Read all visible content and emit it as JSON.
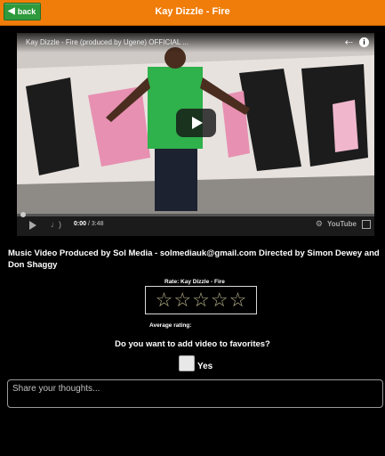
{
  "header": {
    "back_label": "back",
    "title": "Kay Dizzle - Fire",
    "bar_color": "#f07d0a",
    "back_color": "#2e9a3c"
  },
  "video": {
    "title": "Kay Dizzle - Fire (produced by Ugene) OFFICIAL ...",
    "time_current": "0:00",
    "time_total": " / 3:48",
    "brand": "YouTube"
  },
  "description": "Music Video Produced by Sol Media - solmediauk@gmail.com Directed by Simon Dewey and Don Shaggy",
  "rating": {
    "label": "Rate: Kay Dizzle - Fire",
    "stars": [
      "☆",
      "☆",
      "☆",
      "☆",
      "☆"
    ],
    "average_label": "Average rating:"
  },
  "favorites": {
    "question": "Do you want to add video to favorites?",
    "yes_label": "Yes",
    "checked": false
  },
  "comment": {
    "placeholder": "Share your thoughts..."
  }
}
